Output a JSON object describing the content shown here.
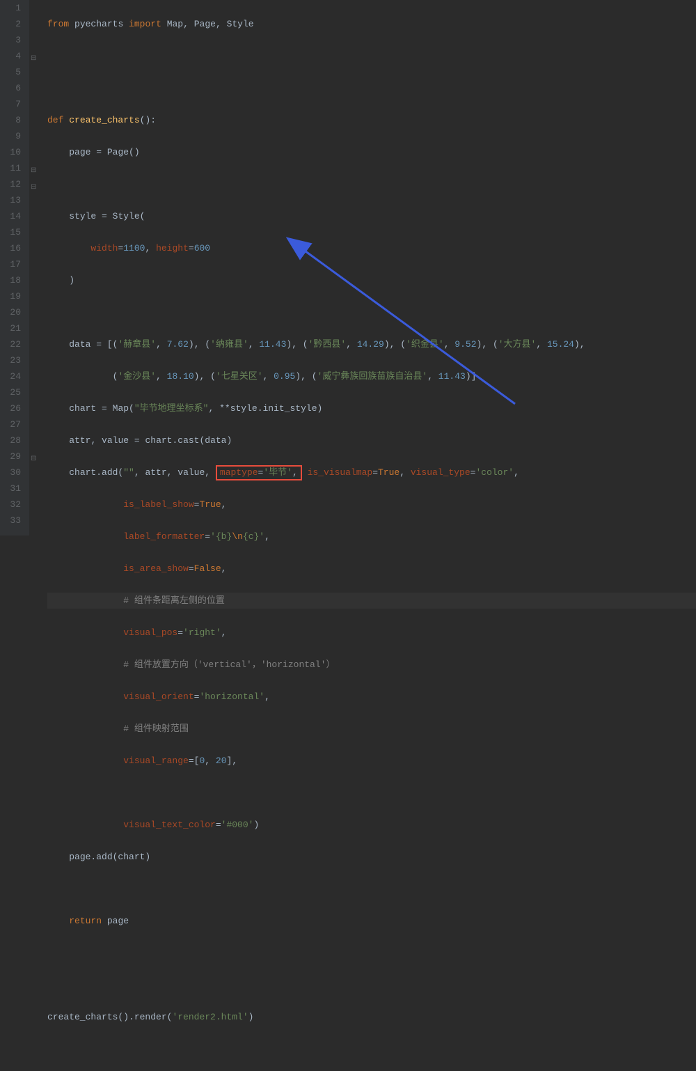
{
  "lines": [
    {
      "n": "1"
    },
    {
      "n": "2"
    },
    {
      "n": "3"
    },
    {
      "n": "4"
    },
    {
      "n": "5"
    },
    {
      "n": "6"
    },
    {
      "n": "7"
    },
    {
      "n": "8"
    },
    {
      "n": "9"
    },
    {
      "n": "10"
    },
    {
      "n": "11"
    },
    {
      "n": "12"
    },
    {
      "n": "13"
    },
    {
      "n": "14"
    },
    {
      "n": "15"
    },
    {
      "n": "16"
    },
    {
      "n": "17"
    },
    {
      "n": "18"
    },
    {
      "n": "19"
    },
    {
      "n": "20"
    },
    {
      "n": "21"
    },
    {
      "n": "22"
    },
    {
      "n": "23"
    },
    {
      "n": "24"
    },
    {
      "n": "25"
    },
    {
      "n": "26"
    },
    {
      "n": "27"
    },
    {
      "n": "28"
    },
    {
      "n": "29"
    },
    {
      "n": "30"
    },
    {
      "n": "31"
    },
    {
      "n": "32"
    },
    {
      "n": "33"
    }
  ],
  "kw_from": "from",
  "id_pyecharts": "pyecharts",
  "kw_import": "import",
  "id_map": "Map",
  "id_page": "Page",
  "id_style": "Style",
  "kw_def": "def",
  "fn_create": "create_charts",
  "op_paren": "()",
  "op_colon": ":",
  "id_page_var": "page",
  "op_eq": " = ",
  "call_page": "Page()",
  "id_style_var": "style",
  "call_style": "Style(",
  "param_width": "width",
  "op_assign": "=",
  "num_1100": "1100",
  "op_comma": ", ",
  "param_height": "height",
  "num_600": "600",
  "op_rparen": ")",
  "id_data": "data",
  "op_eq2": " = ",
  "op_lbrack": "[",
  "op_lparen": "(",
  "str_hz": "'赫章县'",
  "num_762": "7.62",
  "op_rparen2": ")",
  "str_ny": "'纳雍县'",
  "num_1143": "11.43",
  "str_qx": "'黔西县'",
  "num_1429": "14.29",
  "str_zj": "'织金县'",
  "num_952": "9.52",
  "str_df": "'大方县'",
  "num_1524": "15.24",
  "str_js": "'金沙县'",
  "num_1810": "18.10",
  "str_qxg": "'七星关区'",
  "num_095": "0.95",
  "str_wn": "'威宁彝族回族苗族自治县'",
  "num_1143b": "11.43",
  "op_rbrack": "]",
  "id_chart": "chart",
  "call_map": "Map(",
  "str_title": "\"毕节地理坐标系\"",
  "op_star": "**",
  "id_styleinit": "style.init_style",
  "id_attr": "attr",
  "id_value": "value",
  "call_cast": "chart.cast(data)",
  "call_add": "chart.add(",
  "str_empty": "\"\"",
  "param_maptype": "maptype",
  "str_bj": "'毕节'",
  "param_isvis": "is_visualmap",
  "id_true": "True",
  "param_vtype": "visual_type",
  "str_color": "'color'",
  "param_lblshow": "is_label_show",
  "param_lblfmt": "label_formatter",
  "str_fmt1": "'{b}",
  "esc_n": "\\n",
  "str_fmt2": "{c}'",
  "param_areashow": "is_area_show",
  "id_false": "False",
  "comment1": "# 组件条距离左侧的位置",
  "param_vpos": "visual_pos",
  "str_right": "'right'",
  "comment2": "# 组件放置方向（'vertical'，'horizontal'）",
  "param_vorient": "visual_orient",
  "str_horiz": "'horizontal'",
  "comment3": "# 组件映射范围",
  "param_vrange": "visual_range",
  "num_0": "0",
  "num_20": "20",
  "param_vtc": "visual_text_color",
  "str_black": "'#000'",
  "call_pageadd": "page.add(chart)",
  "kw_return": "return",
  "id_page_ret": "page",
  "call_create": "create_charts().render(",
  "str_render": "'render2.html'"
}
